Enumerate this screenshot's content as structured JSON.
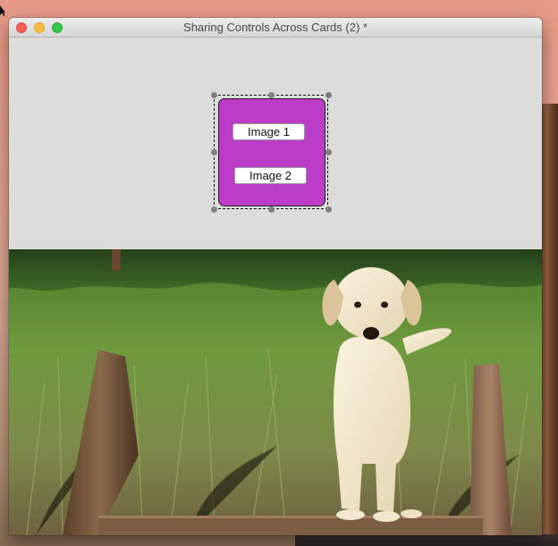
{
  "window": {
    "title": "Sharing Controls Across Cards (2) *"
  },
  "card": {
    "group": {
      "fill_color": "#bb3cc6",
      "buttons": [
        {
          "label": "Image 1"
        },
        {
          "label": "Image 2"
        }
      ]
    }
  },
  "image": {
    "subject_icon": "puppy-photo"
  },
  "colors": {
    "close": "#fc605c",
    "minimize": "#fdbc40",
    "zoom": "#34c84a",
    "card_background": "#dcdcdc"
  }
}
